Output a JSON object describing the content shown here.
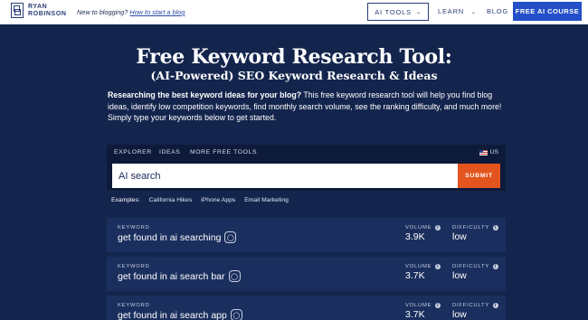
{
  "brand": {
    "line1": "RYAN",
    "line2": "ROBINSON"
  },
  "tagline": {
    "text": "New to blogging?",
    "link": "How to start a blog"
  },
  "nav": {
    "ai_tools": "AI TOOLS",
    "learn": "LEARN",
    "blog": "BLOG",
    "cta": "FREE AI COURSE"
  },
  "hero": {
    "title": "Free Keyword Research Tool:",
    "subtitle": "(AI-Powered) SEO Keyword Research & Ideas",
    "intro_bold": "Researching the best keyword ideas for your blog?",
    "intro_rest": " This free keyword research tool will help you find blog ideas, identify low competition keywords, find monthly search volume, see the ranking difficulty, and much more! Simply type your keywords below to get started."
  },
  "tool": {
    "tabs": [
      "EXPLORER",
      "IDEAS",
      "MORE FREE TOOLS"
    ],
    "region": "US",
    "search_value": "AI search",
    "submit": "SUBMIT"
  },
  "examples": {
    "label": "Examples:",
    "items": [
      "California Hikes",
      "iPhone Apps",
      "Email Marketing"
    ]
  },
  "results": {
    "keyword_label": "KEYWORD",
    "volume_label": "VOLUME",
    "difficulty_label": "DIFFICULTY",
    "rows": [
      {
        "keyword": "get found in ai searching",
        "volume": "3.9K",
        "difficulty": "low"
      },
      {
        "keyword": "get found in ai search bar",
        "volume": "3.7K",
        "difficulty": "low"
      },
      {
        "keyword": "get found in ai search app",
        "volume": "3.7K",
        "difficulty": "low"
      }
    ]
  },
  "colors": {
    "background": "#14254d",
    "row": "#1b2f5e",
    "submit": "#e3541e",
    "cta": "#2350c8"
  },
  "icons": [
    "logo-icon",
    "chevron-down-icon",
    "us-flag-icon",
    "info-icon",
    "lightbulb-icon"
  ]
}
